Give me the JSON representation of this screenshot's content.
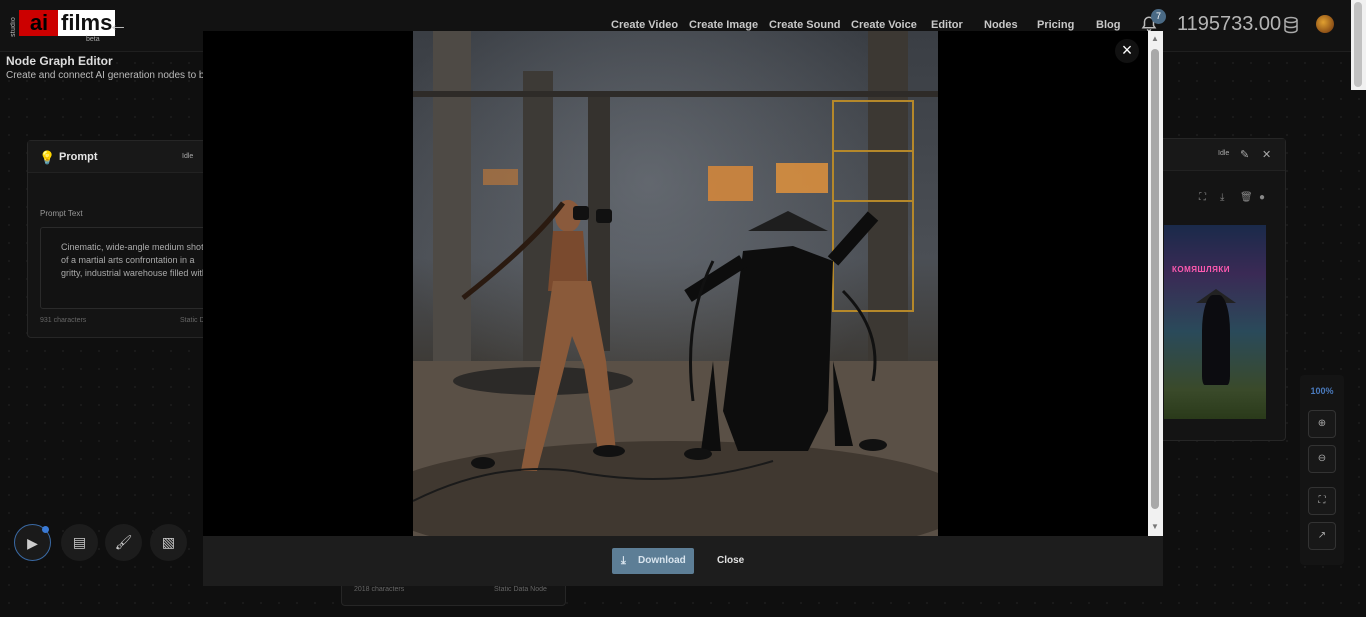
{
  "app": {
    "logo_studio": "studio",
    "logo_ai": "ai",
    "logo_films": "films",
    "logo_beta": "beta",
    "back_icon": "arrow-left-icon"
  },
  "nav": {
    "items": [
      "Create Video",
      "Create Image",
      "Create Sound",
      "Create Voice",
      "Editor",
      "Nodes",
      "Pricing",
      "Blog"
    ]
  },
  "header": {
    "notification_count": "7",
    "credits": "1195733.00"
  },
  "subheader": {
    "title": "Node Graph Editor",
    "description": "Create and connect AI generation nodes to build"
  },
  "prompt_node": {
    "title": "Prompt",
    "status": "Idle",
    "field_label": "Prompt Text",
    "text": "Cinematic, wide-angle medium shot of a martial arts confrontation in a gritty, industrial warehouse filled with",
    "char_count": "931 characters",
    "type_label": "Static D"
  },
  "image_node": {
    "status": "Idle",
    "thumb_sign": "КОМЯШЛЯКИ"
  },
  "bottom_node": {
    "char_count": "2018 characters",
    "type_label": "Static Data Node"
  },
  "zoom": {
    "level": "100%"
  },
  "modal": {
    "download_label": "Download",
    "close_label": "Close",
    "close_icon": "×"
  },
  "colors": {
    "accent_blue": "#4a7abd",
    "download_bg": "#5d7e96",
    "logo_red": "#cc0000"
  }
}
